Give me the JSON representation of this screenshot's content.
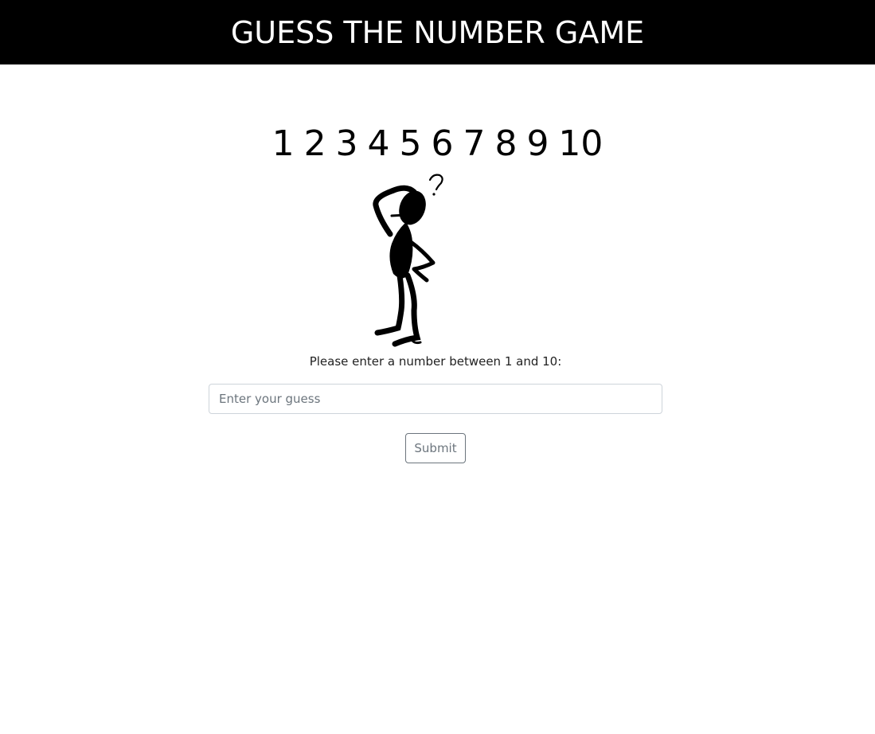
{
  "header": {
    "title": "GUESS THE NUMBER GAME",
    "background": "#000000",
    "text_color": "#ffffff"
  },
  "numbers_banner": {
    "text": "1 2 3 4 5 6 7 8 9 10"
  },
  "illustration": {
    "icon": "thinking-stick-figure-icon",
    "caption_glyph": "?"
  },
  "form": {
    "prompt": "Please enter a number between 1 and 10:",
    "input_placeholder": "Enter your guess",
    "input_value": "",
    "submit_label": "Submit"
  }
}
